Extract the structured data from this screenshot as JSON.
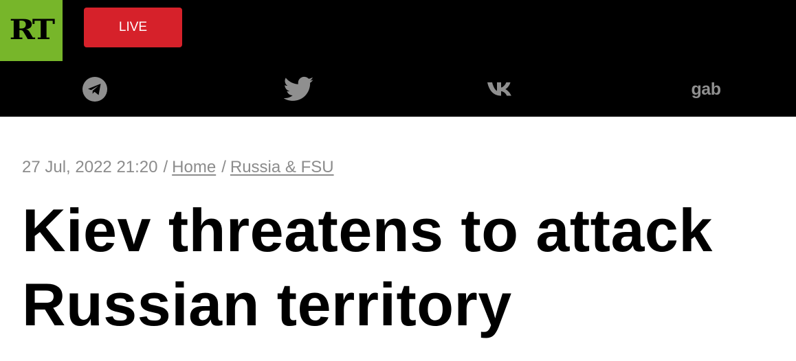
{
  "header": {
    "logo_text": "RT",
    "live_label": "LIVE",
    "colors": {
      "logo_bg": "#77b62a",
      "live_bg": "#d6212a",
      "bar_bg": "#000000",
      "icon_gray": "#8f8f8f"
    },
    "social": [
      {
        "name": "telegram",
        "icon": "telegram-icon"
      },
      {
        "name": "twitter",
        "icon": "twitter-icon"
      },
      {
        "name": "vk",
        "icon": "vk-icon"
      },
      {
        "name": "gab",
        "icon": "gab-icon",
        "label": "gab"
      }
    ]
  },
  "article": {
    "timestamp": "27 Jul, 2022 21:20",
    "separator": "/",
    "breadcrumb": [
      {
        "label": "Home"
      },
      {
        "label": "Russia & FSU"
      }
    ],
    "headline": "Kiev threatens to attack Russian territory"
  }
}
